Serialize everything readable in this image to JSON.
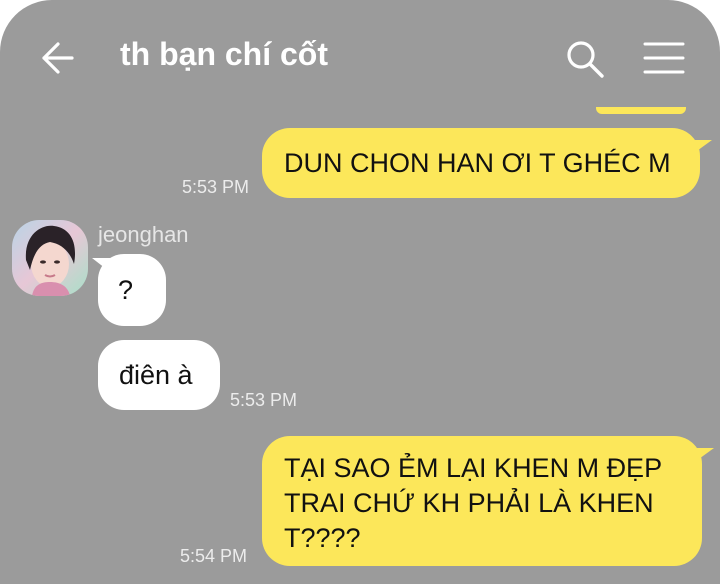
{
  "header": {
    "title": "th bạn chí cốt",
    "back_icon": "arrow-left-icon",
    "search_icon": "search-icon",
    "menu_icon": "hamburger-menu-icon"
  },
  "colors": {
    "background": "#9b9b9b",
    "my_bubble": "#fce75a",
    "their_bubble": "#ffffff",
    "text_light": "#ffffff"
  },
  "messages": [
    {
      "sender": "me",
      "text": "DUN CHON HAN ƠI T GHÉC M",
      "time": "5:53 PM"
    },
    {
      "sender": "jeonghan",
      "text": "?"
    },
    {
      "sender": "jeonghan",
      "text": "điên à",
      "time": "5:53 PM"
    },
    {
      "sender": "me",
      "lines": [
        "TẠI SAO ẺM LẠI KHEN M ĐẸP",
        "TRAI CHỨ KH PHẢI LÀ KHEN",
        "T????"
      ],
      "time": "5:54 PM"
    }
  ],
  "contact": {
    "name": "jeonghan"
  }
}
